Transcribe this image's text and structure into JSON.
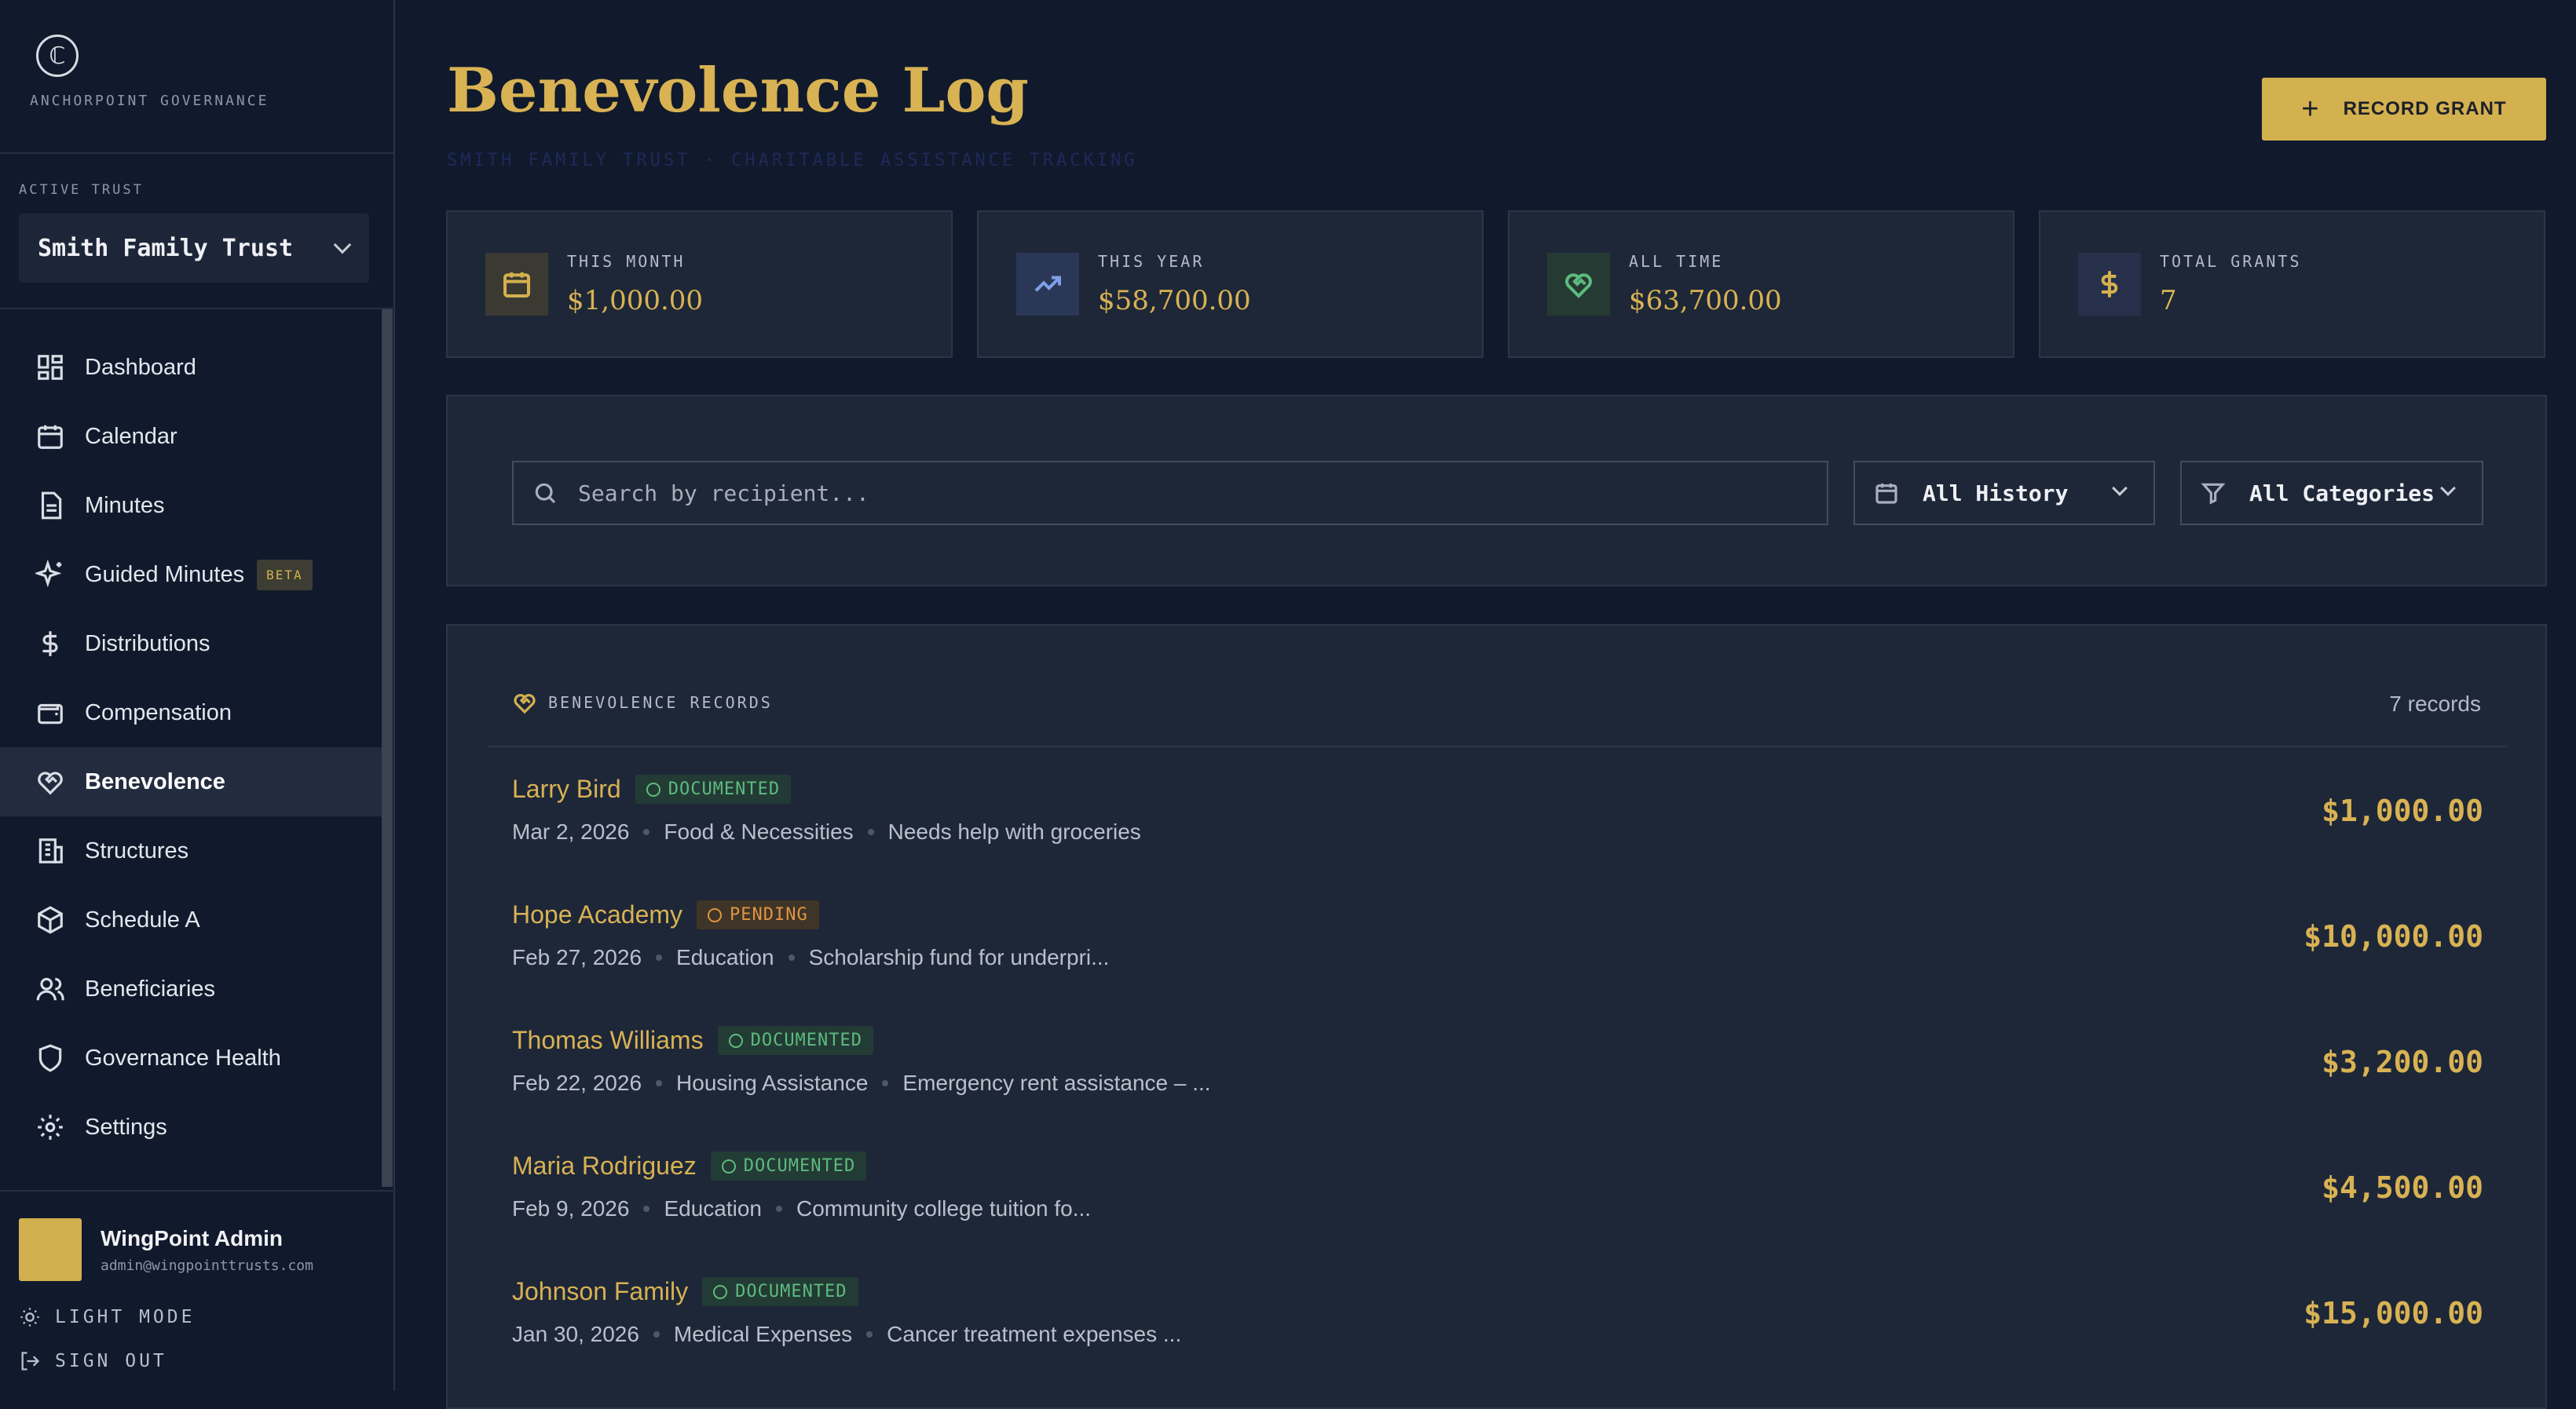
{
  "brand": {
    "logo_glyph": "ℂ",
    "name": "ANCHORPOINT GOVERNANCE"
  },
  "trust": {
    "label": "ACTIVE TRUST",
    "selected": "Smith Family Trust"
  },
  "nav": [
    {
      "label": "Dashboard",
      "icon": "dashboard-icon"
    },
    {
      "label": "Calendar",
      "icon": "calendar-icon"
    },
    {
      "label": "Minutes",
      "icon": "document-icon"
    },
    {
      "label": "Guided Minutes",
      "icon": "sparkle-icon",
      "badge": "BETA"
    },
    {
      "label": "Distributions",
      "icon": "dollar-icon"
    },
    {
      "label": "Compensation",
      "icon": "wallet-icon"
    },
    {
      "label": "Benevolence",
      "icon": "heart-handshake-icon",
      "active": true
    },
    {
      "label": "Structures",
      "icon": "building-icon"
    },
    {
      "label": "Schedule A",
      "icon": "box-icon"
    },
    {
      "label": "Beneficiaries",
      "icon": "users-icon"
    },
    {
      "label": "Governance Health",
      "icon": "shield-icon"
    },
    {
      "label": "Settings",
      "icon": "gear-icon"
    }
  ],
  "user": {
    "name": "WingPoint Admin",
    "email": "admin@wingpointtrusts.com"
  },
  "footer": {
    "light_mode": "LIGHT MODE",
    "sign_out": "SIGN OUT"
  },
  "page": {
    "title": "Benevolence Log",
    "subtitle": "SMITH FAMILY TRUST · CHARITABLE ASSISTANCE TRACKING",
    "record_button": "RECORD GRANT"
  },
  "stats": [
    {
      "label": "THIS MONTH",
      "value": "$1,000.00",
      "icon": "calendar-icon",
      "bg": "#3b3a32",
      "color": "#d4b14f"
    },
    {
      "label": "THIS YEAR",
      "value": "$58,700.00",
      "icon": "trending-up-icon",
      "bg": "#2a3756",
      "color": "#7fa0e8"
    },
    {
      "label": "ALL TIME",
      "value": "$63,700.00",
      "icon": "heart-handshake-icon",
      "bg": "#253a33",
      "color": "#5dbb7e"
    },
    {
      "label": "TOTAL GRANTS",
      "value": "7",
      "icon": "dollar-icon",
      "bg": "#26304a",
      "color": "#d4b14f"
    }
  ],
  "filters": {
    "search_placeholder": "Search by recipient...",
    "history": "All History",
    "categories": "All Categories"
  },
  "records": {
    "title": "BENEVOLENCE RECORDS",
    "count": "7 records",
    "items": [
      {
        "name": "Larry Bird",
        "status": "DOCUMENTED",
        "date": "Mar 2, 2026",
        "category": "Food & Necessities",
        "note": "Needs help with groceries",
        "amount": "$1,000.00"
      },
      {
        "name": "Hope Academy",
        "status": "PENDING",
        "date": "Feb 27, 2026",
        "category": "Education",
        "note": "Scholarship fund for underpri...",
        "amount": "$10,000.00"
      },
      {
        "name": "Thomas Williams",
        "status": "DOCUMENTED",
        "date": "Feb 22, 2026",
        "category": "Housing Assistance",
        "note": "Emergency rent assistance – ...",
        "amount": "$3,200.00"
      },
      {
        "name": "Maria Rodriguez",
        "status": "DOCUMENTED",
        "date": "Feb 9, 2026",
        "category": "Education",
        "note": "Community college tuition fo...",
        "amount": "$4,500.00"
      },
      {
        "name": "Johnson Family",
        "status": "DOCUMENTED",
        "date": "Jan 30, 2026",
        "category": "Medical Expenses",
        "note": "Cancer treatment expenses ...",
        "amount": "$15,000.00"
      }
    ]
  }
}
